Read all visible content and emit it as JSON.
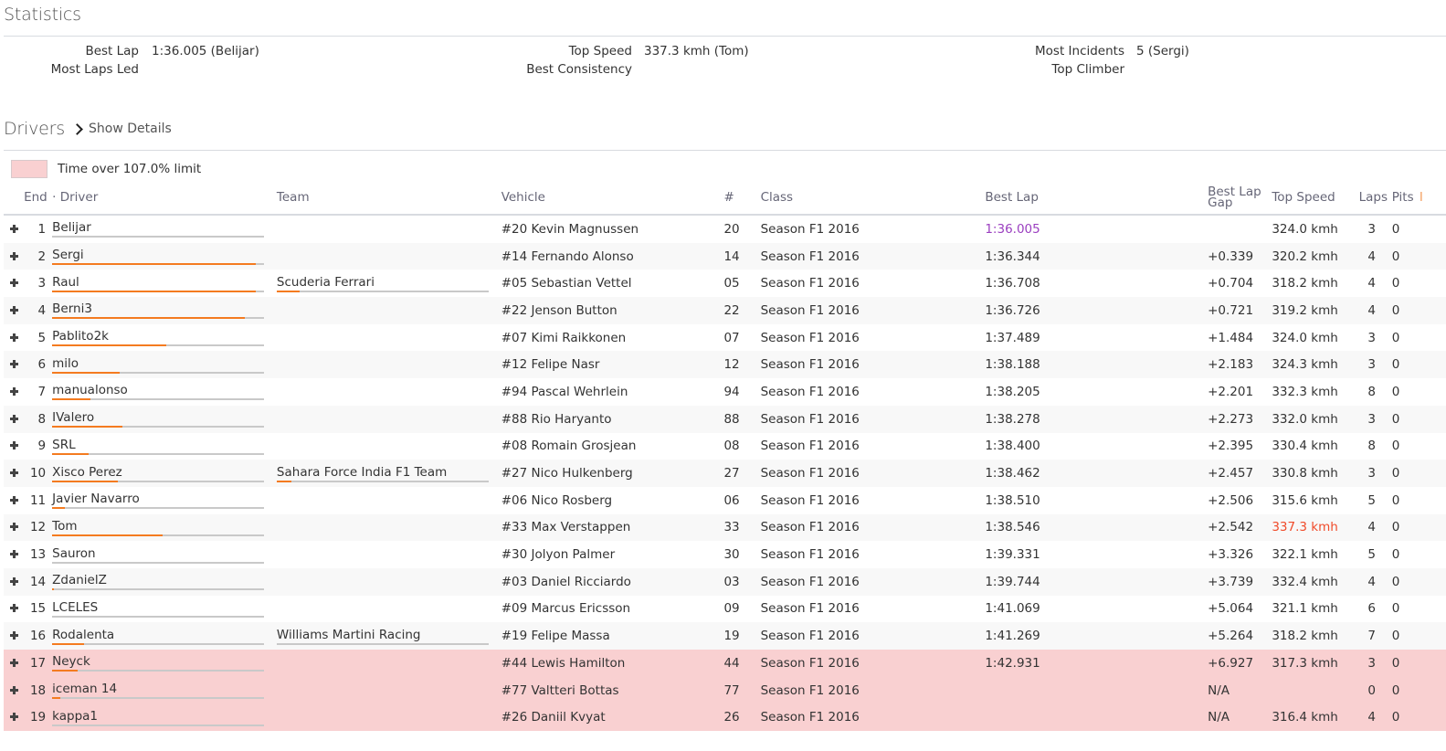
{
  "statistics": {
    "title": "Statistics",
    "items": [
      {
        "label": "Best Lap",
        "value": "1:36.005 (Belijar)"
      },
      {
        "label": "Most Laps Led",
        "value": ""
      },
      {
        "label": "Top Speed",
        "value": "337.3 kmh (Tom)"
      },
      {
        "label": "Best Consistency",
        "value": ""
      },
      {
        "label": "Most Incidents",
        "value": "5 (Sergi)"
      },
      {
        "label": "Top Climber",
        "value": ""
      }
    ]
  },
  "drivers": {
    "title": "Drivers",
    "show_details_label": "Show Details",
    "legend_text": "Time over 107.0% limit",
    "colors": {
      "over_limit": "#f9d0d1",
      "bar_fill": "#f47b20",
      "bar_track": "#c9c9c9",
      "best_lap": "#9b3fc0",
      "top_speed": "#f04b2a"
    },
    "columns": {
      "end": "End",
      "sort_dot": "·",
      "driver": "Driver",
      "team": "Team",
      "vehicle": "Vehicle",
      "number": "#",
      "class": "Class",
      "best_lap": "Best Lap",
      "best_lap_gap_1": "Best Lap",
      "best_lap_gap_2": "Gap",
      "top_speed": "Top Speed",
      "laps": "Laps",
      "pits": "Pits",
      "incidents_partial": "I"
    },
    "rows": [
      {
        "end": "1",
        "driver": "Belijar",
        "driver_bar": 0,
        "team": "",
        "team_bar": null,
        "vehicle": "#20 Kevin Magnussen",
        "number": "20",
        "class": "Season F1 2016",
        "best_lap": "1:36.005",
        "gap": "",
        "top_speed": "324.0 kmh",
        "laps": "3",
        "pits": "0",
        "over_limit": false,
        "best_highlight": true,
        "speed_highlight": false
      },
      {
        "end": "2",
        "driver": "Sergi",
        "driver_bar": 0.96,
        "team": "",
        "team_bar": null,
        "vehicle": "#14 Fernando Alonso",
        "number": "14",
        "class": "Season F1 2016",
        "best_lap": "1:36.344",
        "gap": "+0.339",
        "top_speed": "320.2 kmh",
        "laps": "4",
        "pits": "0",
        "over_limit": false
      },
      {
        "end": "3",
        "driver": "Raul",
        "driver_bar": 0.96,
        "team": "Scuderia Ferrari",
        "team_bar": 0.11,
        "vehicle": "#05 Sebastian Vettel",
        "number": "05",
        "class": "Season F1 2016",
        "best_lap": "1:36.708",
        "gap": "+0.704",
        "top_speed": "318.2 kmh",
        "laps": "4",
        "pits": "0",
        "over_limit": false
      },
      {
        "end": "4",
        "driver": "Berni3",
        "driver_bar": 0.91,
        "team": "",
        "team_bar": null,
        "vehicle": "#22 Jenson Button",
        "number": "22",
        "class": "Season F1 2016",
        "best_lap": "1:36.726",
        "gap": "+0.721",
        "top_speed": "319.2 kmh",
        "laps": "4",
        "pits": "0",
        "over_limit": false
      },
      {
        "end": "5",
        "driver": "Pablito2k",
        "driver_bar": 0.54,
        "team": "",
        "team_bar": null,
        "vehicle": "#07 Kimi Raikkonen",
        "number": "07",
        "class": "Season F1 2016",
        "best_lap": "1:37.489",
        "gap": "+1.484",
        "top_speed": "324.0 kmh",
        "laps": "3",
        "pits": "0",
        "over_limit": false
      },
      {
        "end": "6",
        "driver": "milo",
        "driver_bar": 0.32,
        "team": "",
        "team_bar": null,
        "vehicle": "#12 Felipe Nasr",
        "number": "12",
        "class": "Season F1 2016",
        "best_lap": "1:38.188",
        "gap": "+2.183",
        "top_speed": "324.3 kmh",
        "laps": "3",
        "pits": "0",
        "over_limit": false
      },
      {
        "end": "7",
        "driver": "manualonso",
        "driver_bar": 0.18,
        "team": "",
        "team_bar": null,
        "vehicle": "#94 Pascal Wehrlein",
        "number": "94",
        "class": "Season F1 2016",
        "best_lap": "1:38.205",
        "gap": "+2.201",
        "top_speed": "332.3 kmh",
        "laps": "8",
        "pits": "0",
        "over_limit": false
      },
      {
        "end": "8",
        "driver": "IValero",
        "driver_bar": 0.33,
        "team": "",
        "team_bar": null,
        "vehicle": "#88 Rio Haryanto",
        "number": "88",
        "class": "Season F1 2016",
        "best_lap": "1:38.278",
        "gap": "+2.273",
        "top_speed": "332.0 kmh",
        "laps": "3",
        "pits": "0",
        "over_limit": false
      },
      {
        "end": "9",
        "driver": "SRL",
        "driver_bar": 0.17,
        "team": "",
        "team_bar": null,
        "vehicle": "#08 Romain Grosjean",
        "number": "08",
        "class": "Season F1 2016",
        "best_lap": "1:38.400",
        "gap": "+2.395",
        "top_speed": "330.4 kmh",
        "laps": "8",
        "pits": "0",
        "over_limit": false
      },
      {
        "end": "10",
        "driver": "Xisco Perez",
        "driver_bar": 0.31,
        "team": "Sahara Force India F1 Team",
        "team_bar": 0.07,
        "vehicle": "#27 Nico Hulkenberg",
        "number": "27",
        "class": "Season F1 2016",
        "best_lap": "1:38.462",
        "gap": "+2.457",
        "top_speed": "330.8 kmh",
        "laps": "3",
        "pits": "0",
        "over_limit": false
      },
      {
        "end": "11",
        "driver": "Javier Navarro",
        "driver_bar": 0.06,
        "team": "",
        "team_bar": null,
        "vehicle": "#06 Nico Rosberg",
        "number": "06",
        "class": "Season F1 2016",
        "best_lap": "1:38.510",
        "gap": "+2.506",
        "top_speed": "315.6 kmh",
        "laps": "5",
        "pits": "0",
        "over_limit": false
      },
      {
        "end": "12",
        "driver": "Tom",
        "driver_bar": 0.52,
        "team": "",
        "team_bar": null,
        "vehicle": "#33 Max Verstappen",
        "number": "33",
        "class": "Season F1 2016",
        "best_lap": "1:38.546",
        "gap": "+2.542",
        "top_speed": "337.3 kmh",
        "laps": "4",
        "pits": "0",
        "over_limit": false,
        "speed_highlight": true
      },
      {
        "end": "13",
        "driver": "Sauron",
        "driver_bar": 0,
        "team": "",
        "team_bar": null,
        "vehicle": "#30 Jolyon Palmer",
        "number": "30",
        "class": "Season F1 2016",
        "best_lap": "1:39.331",
        "gap": "+3.326",
        "top_speed": "322.1 kmh",
        "laps": "5",
        "pits": "0",
        "over_limit": false
      },
      {
        "end": "14",
        "driver": "ZdanielZ",
        "driver_bar": 0.01,
        "team": "",
        "team_bar": null,
        "vehicle": "#03 Daniel Ricciardo",
        "number": "03",
        "class": "Season F1 2016",
        "best_lap": "1:39.744",
        "gap": "+3.739",
        "top_speed": "332.4 kmh",
        "laps": "4",
        "pits": "0",
        "over_limit": false
      },
      {
        "end": "15",
        "driver": "LCELES",
        "driver_bar": 0,
        "team": "",
        "team_bar": null,
        "vehicle": "#09 Marcus Ericsson",
        "number": "09",
        "class": "Season F1 2016",
        "best_lap": "1:41.069",
        "gap": "+5.064",
        "top_speed": "321.1 kmh",
        "laps": "6",
        "pits": "0",
        "over_limit": false
      },
      {
        "end": "16",
        "driver": "Rodalenta",
        "driver_bar": 0.15,
        "team": "Williams Martini Racing",
        "team_bar": 0,
        "vehicle": "#19 Felipe Massa",
        "number": "19",
        "class": "Season F1 2016",
        "best_lap": "1:41.269",
        "gap": "+5.264",
        "top_speed": "318.2 kmh",
        "laps": "7",
        "pits": "0",
        "over_limit": false
      },
      {
        "end": "17",
        "driver": "Neyck",
        "driver_bar": 0.12,
        "team": "",
        "team_bar": null,
        "vehicle": "#44 Lewis Hamilton",
        "number": "44",
        "class": "Season F1 2016",
        "best_lap": "1:42.931",
        "gap": "+6.927",
        "top_speed": "317.3 kmh",
        "laps": "3",
        "pits": "0",
        "over_limit": true
      },
      {
        "end": "18",
        "driver": "iceman 14",
        "driver_bar": 0.04,
        "team": "",
        "team_bar": null,
        "vehicle": "#77 Valtteri Bottas",
        "number": "77",
        "class": "Season F1 2016",
        "best_lap": "",
        "gap": "N/A",
        "top_speed": "",
        "laps": "0",
        "pits": "0",
        "over_limit": true
      },
      {
        "end": "19",
        "driver": "kappa1",
        "driver_bar": 0,
        "team": "",
        "team_bar": null,
        "vehicle": "#26 Daniil Kvyat",
        "number": "26",
        "class": "Season F1 2016",
        "best_lap": "",
        "gap": "N/A",
        "top_speed": "316.4 kmh",
        "laps": "4",
        "pits": "0",
        "over_limit": true
      }
    ]
  }
}
